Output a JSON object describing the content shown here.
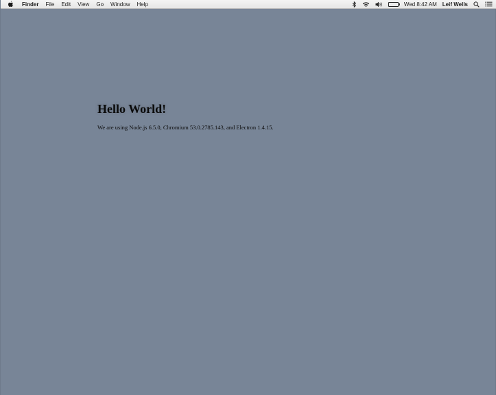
{
  "menubar": {
    "app_name": "Finder",
    "menus": [
      "File",
      "Edit",
      "View",
      "Go",
      "Window",
      "Help"
    ],
    "status": {
      "clock": "Wed 8:42 AM",
      "user": "Leif Wells",
      "battery_label": " "
    }
  },
  "app": {
    "heading": "Hello World!",
    "versions_line": "We are using Node.js 6.5.0, Chromium 53.0.2785.143, and Electron 1.4.15."
  },
  "colors": {
    "desktop": "#788597",
    "menubar": "#ececec"
  },
  "icons": [
    "apple-icon",
    "bluetooth-icon",
    "wifi-icon",
    "volume-icon",
    "battery-icon",
    "spotlight-search-icon",
    "notification-center-icon"
  ]
}
